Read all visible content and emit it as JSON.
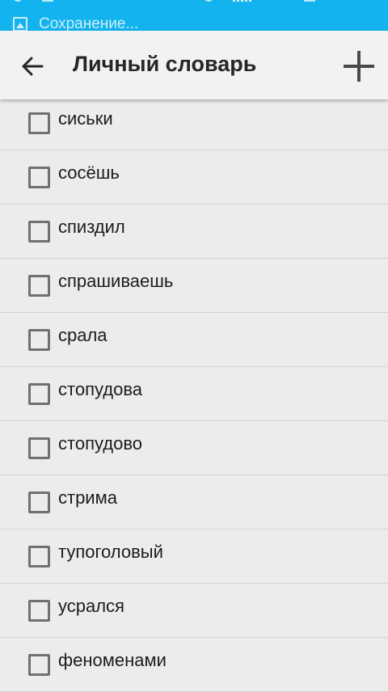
{
  "statusbar": {
    "notification_text": "Сохранение..."
  },
  "appbar": {
    "title": "Личный словарь",
    "back_icon": "arrow-left-icon",
    "add_icon": "plus-icon"
  },
  "words": [
    {
      "text": "сиськи",
      "checked": false
    },
    {
      "text": "сосёшь",
      "checked": false
    },
    {
      "text": "спиздил",
      "checked": false
    },
    {
      "text": "спрашиваешь",
      "checked": false
    },
    {
      "text": "срала",
      "checked": false
    },
    {
      "text": "стопудова",
      "checked": false
    },
    {
      "text": "стопудово",
      "checked": false
    },
    {
      "text": "стрима",
      "checked": false
    },
    {
      "text": "тупоголовый",
      "checked": false
    },
    {
      "text": "усрался",
      "checked": false
    },
    {
      "text": "феноменами",
      "checked": false
    }
  ],
  "colors": {
    "statusbar": "#12b3ee",
    "appbar": "#f2f2f2",
    "background": "#ececec"
  }
}
